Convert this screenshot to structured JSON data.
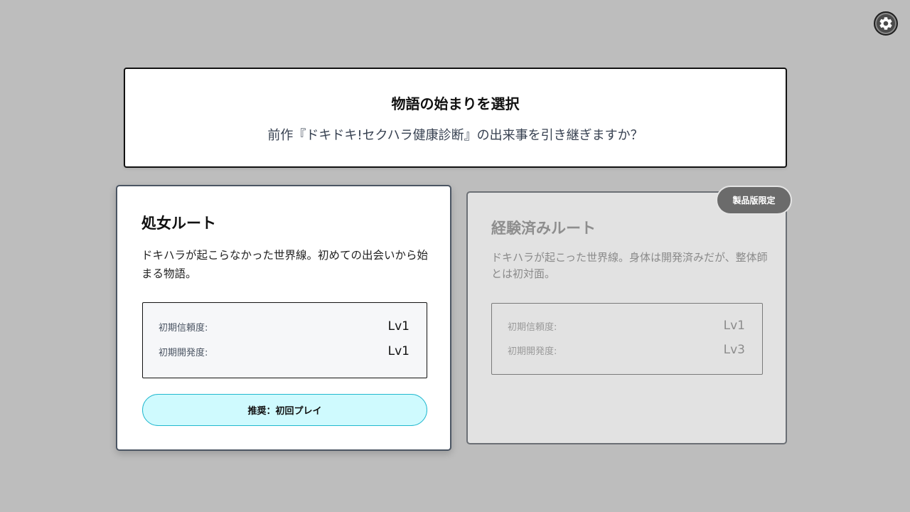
{
  "settings": {
    "icon": "gear-icon"
  },
  "header": {
    "title": "物語の始まりを選択",
    "subtitle": "前作『ドキドキ!セクハラ健康診断』の出来事を引き継ぎますか？"
  },
  "routes": [
    {
      "title": "処女ルート",
      "description": "ドキハラが起こらなかった世界線。初めての出会いから始まる物語。",
      "stats": [
        {
          "label": "初期信頼度:",
          "value": "Lv1"
        },
        {
          "label": "初期開発度:",
          "value": "Lv1"
        }
      ],
      "button_label": "推奨：初回プレイ"
    },
    {
      "title": "経験済みルート",
      "description": "ドキハラが起こった世界線。身体は開発済みだが、整体師とは初対面。",
      "badge": "製品版限定",
      "stats": [
        {
          "label": "初期信頼度:",
          "value": "Lv1"
        },
        {
          "label": "初期開発度:",
          "value": "Lv3"
        }
      ]
    }
  ]
}
